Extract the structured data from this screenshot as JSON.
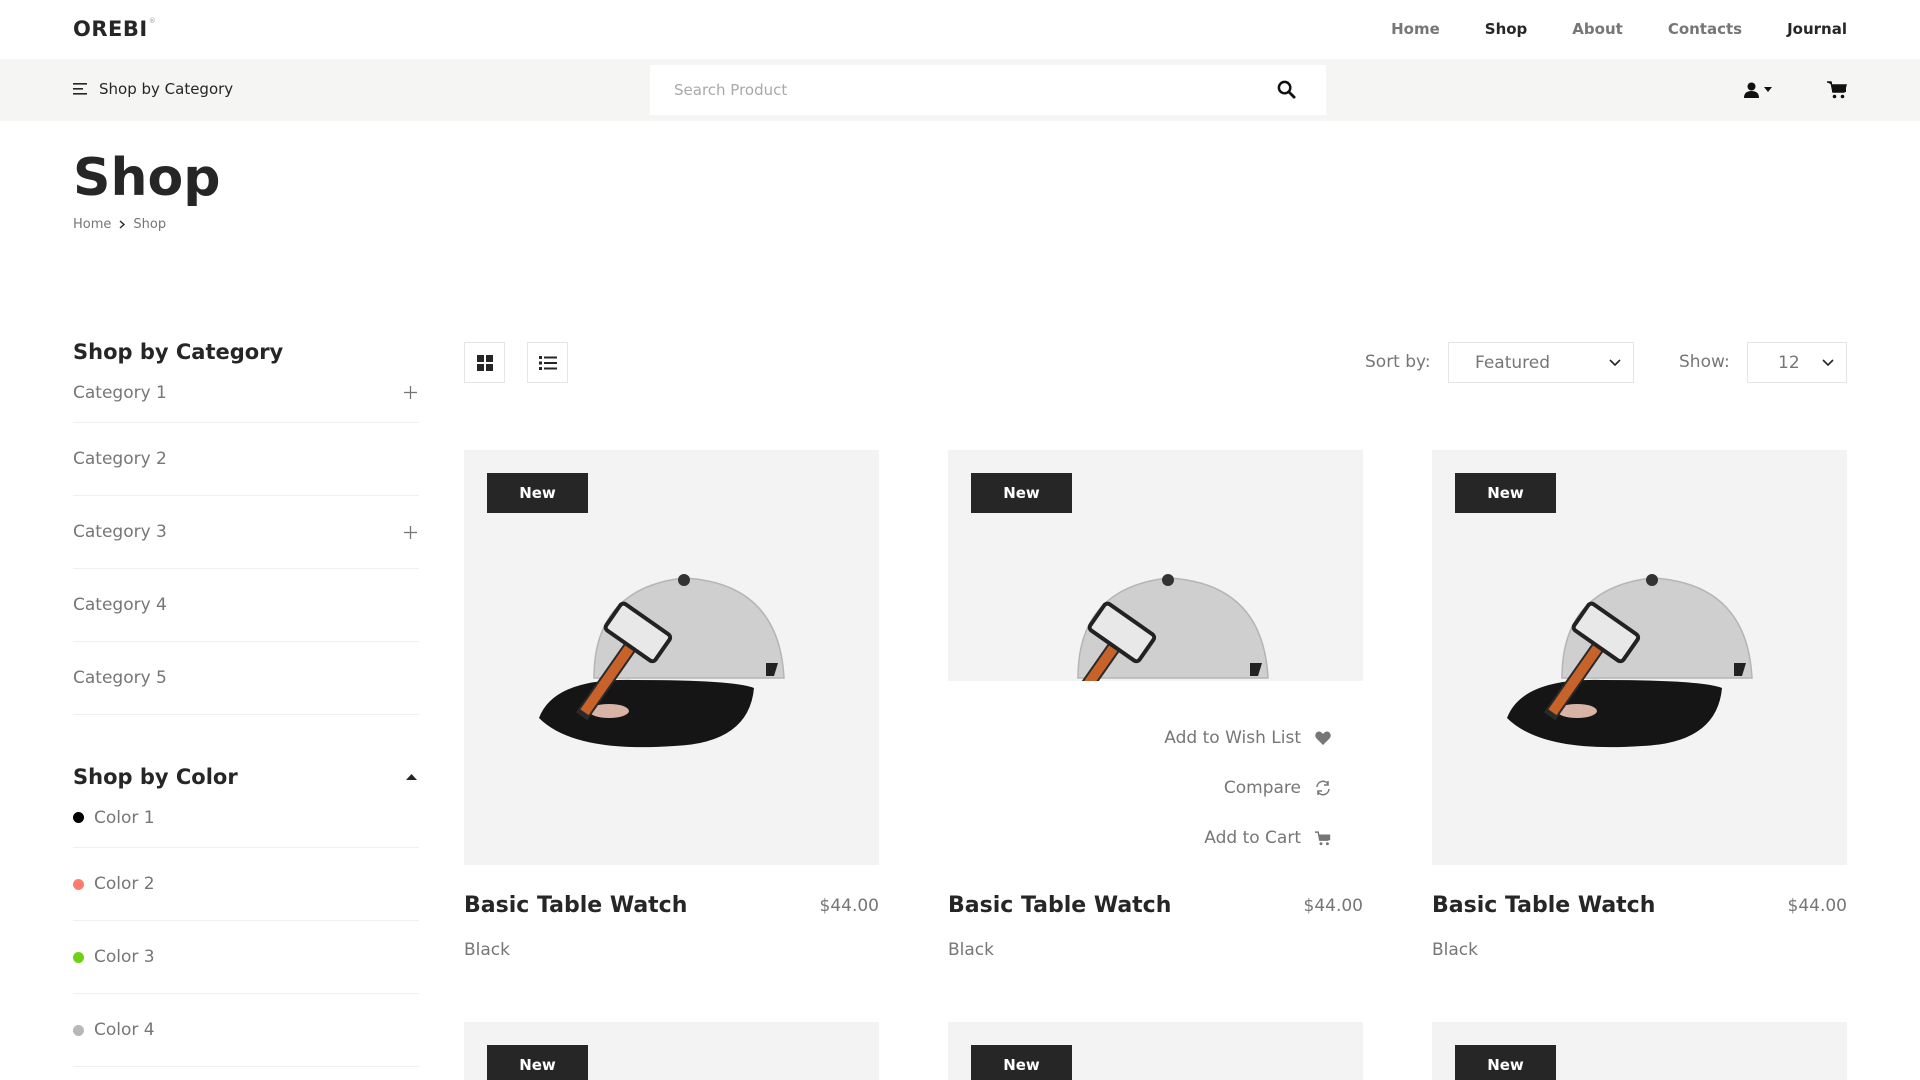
{
  "header": {
    "logo": "OREBI",
    "nav": [
      "Home",
      "Shop",
      "About",
      "Contacts",
      "Journal"
    ]
  },
  "subbar": {
    "shop_by_category": "Shop by Category",
    "search_placeholder": "Search Product"
  },
  "page": {
    "title": "Shop",
    "breadcrumb": [
      "Home",
      "Shop"
    ]
  },
  "sidebar": {
    "category_heading": "Shop by Category",
    "categories": [
      "Category 1",
      "Category 2",
      "Category 3",
      "Category 4",
      "Category 5"
    ],
    "color_heading": "Shop by Color",
    "colors": [
      {
        "label": "Color 1",
        "hex": "#000000"
      },
      {
        "label": "Color 2",
        "hex": "#ff7c6d"
      },
      {
        "label": "Color 3",
        "hex": "#6ed116"
      },
      {
        "label": "Color 4",
        "hex": "#b8b8b8"
      }
    ]
  },
  "toolbar": {
    "sort_label": "Sort by:",
    "sort_value": "Featured",
    "show_label": "Show:",
    "show_value": "12"
  },
  "products": [
    {
      "badge": "New",
      "name": "Basic Table Watch",
      "price": "$44.00",
      "color": "Black"
    },
    {
      "badge": "New",
      "name": "Basic Table Watch",
      "price": "$44.00",
      "color": "Black"
    },
    {
      "badge": "New",
      "name": "Basic Table Watch",
      "price": "$44.00",
      "color": "Black"
    },
    {
      "badge": "New"
    },
    {
      "badge": "New"
    },
    {
      "badge": "New"
    }
  ],
  "hover_actions": {
    "wishlist": "Add to Wish List",
    "compare": "Compare",
    "add_to_cart": "Add to Cart"
  },
  "colors": {
    "text": "#262626",
    "muted": "#767676",
    "subbar_bg": "#f5f5f3",
    "card_bg": "#f3f3f3"
  }
}
